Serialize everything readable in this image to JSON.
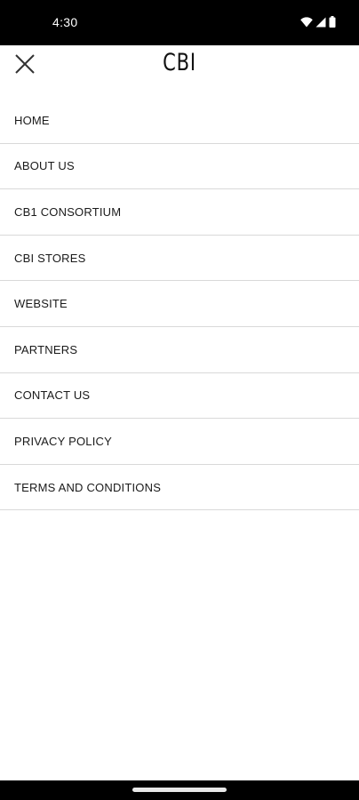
{
  "status_bar": {
    "time": "4:30",
    "icons": [
      "wifi-icon",
      "signal-icon",
      "battery-icon"
    ]
  },
  "header": {
    "brand": "CBI",
    "close_icon": "close-icon"
  },
  "menu": {
    "items": [
      {
        "label": "HOME"
      },
      {
        "label": "ABOUT US"
      },
      {
        "label": "CB1 CONSORTIUM"
      },
      {
        "label": "CBI STORES"
      },
      {
        "label": "WEBSITE"
      },
      {
        "label": "PARTNERS"
      },
      {
        "label": "CONTACT US"
      },
      {
        "label": "PRIVACY POLICY"
      },
      {
        "label": "TERMS AND CONDITIONS"
      }
    ]
  },
  "colors": {
    "status_bar_bg": "#000000",
    "background": "#ffffff",
    "divider": "#d9d9d9",
    "text": "#1a1a1a"
  }
}
